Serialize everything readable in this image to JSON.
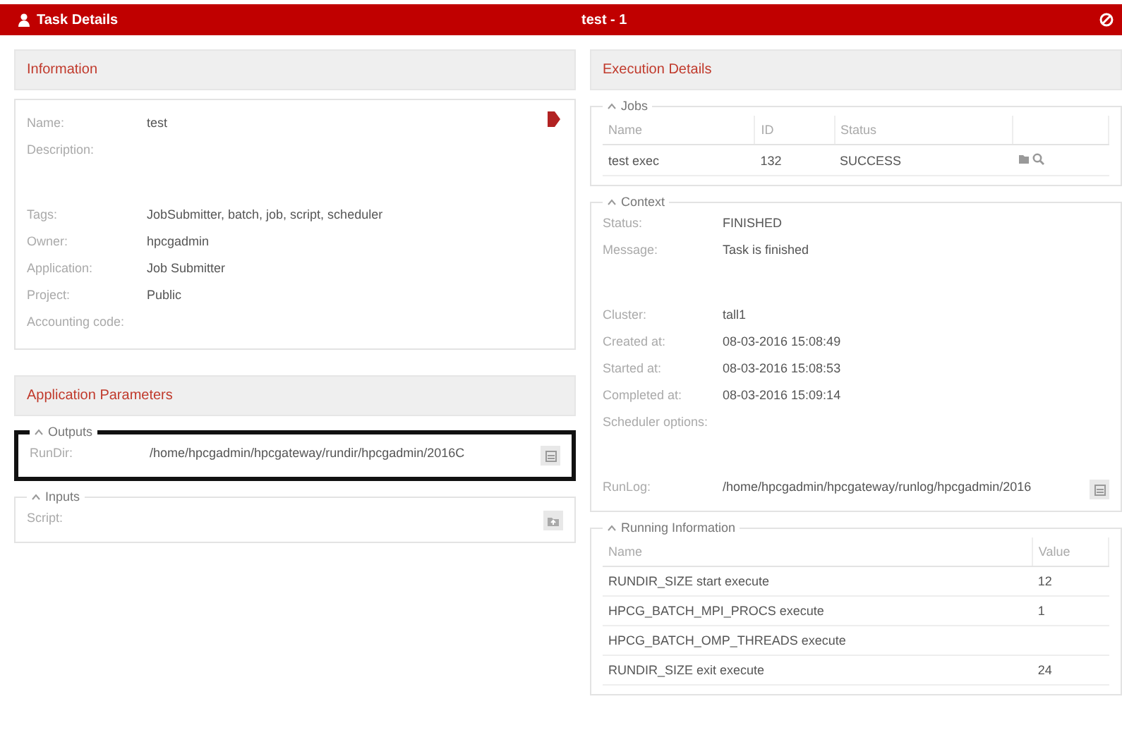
{
  "window": {
    "title": "Task Details",
    "subtitle": "test - 1"
  },
  "information": {
    "title": "Information",
    "fields": [
      {
        "label": "Name:",
        "value": "test",
        "kind": "text"
      },
      {
        "label": "Description:",
        "kind": "multiline"
      },
      {
        "label": "Tags:",
        "value": "JobSubmitter, batch, job, script, scheduler",
        "kind": "text"
      },
      {
        "label": "Owner:",
        "value": "hpcgadmin",
        "kind": "text"
      },
      {
        "label": "Application:",
        "value": "Job Submitter",
        "kind": "text"
      },
      {
        "label": "Project:",
        "value": "Public",
        "kind": "text"
      },
      {
        "label": "Accounting code:",
        "kind": "text"
      }
    ]
  },
  "application_parameters": {
    "title": "Application Parameters",
    "groups": [
      {
        "legend": "Outputs",
        "highlighted": true,
        "fields": [
          {
            "label": "RunDir:",
            "value": "/home/hpcgadmin/hpcgateway/rundir/hpcgadmin/2016C",
            "kind": "path"
          }
        ]
      },
      {
        "legend": "Inputs",
        "highlighted": false,
        "fields": [
          {
            "label": "Script:",
            "kind": "file"
          }
        ]
      }
    ]
  },
  "execution_details": {
    "title": "Execution Details",
    "jobs": {
      "legend": "Jobs",
      "columns": [
        "Name",
        "ID",
        "Status"
      ],
      "rows": [
        {
          "cells": [
            "test exec",
            "132",
            "SUCCESS"
          ]
        }
      ]
    },
    "context": {
      "legend": "Context",
      "fields": [
        {
          "label": "Status:",
          "value": "FINISHED",
          "kind": "text"
        },
        {
          "label": "Message:",
          "value": "Task is finished",
          "kind": "multiline"
        },
        {
          "label": "Cluster:",
          "value": "tall1",
          "kind": "text"
        },
        {
          "label": "Created at:",
          "value": "08-03-2016 15:08:49",
          "kind": "text"
        },
        {
          "label": "Started at:",
          "value": "08-03-2016 15:08:53",
          "kind": "text"
        },
        {
          "label": "Completed at:",
          "value": "08-03-2016 15:09:14",
          "kind": "text"
        },
        {
          "label": "Scheduler options:",
          "kind": "multiline"
        },
        {
          "label": "RunLog:",
          "value": "/home/hpcgadmin/hpcgateway/runlog/hpcgadmin/2016",
          "kind": "path"
        }
      ]
    },
    "running_information": {
      "legend": "Running Information",
      "columns": [
        "Name",
        "Value"
      ],
      "rows": [
        {
          "cells": [
            "RUNDIR_SIZE start execute",
            "12"
          ]
        },
        {
          "cells": [
            "HPCG_BATCH_MPI_PROCS execute",
            "1"
          ]
        },
        {
          "cells": [
            "HPCG_BATCH_OMP_THREADS execute"
          ]
        },
        {
          "cells": [
            "RUNDIR_SIZE exit execute",
            "24"
          ]
        }
      ]
    }
  }
}
